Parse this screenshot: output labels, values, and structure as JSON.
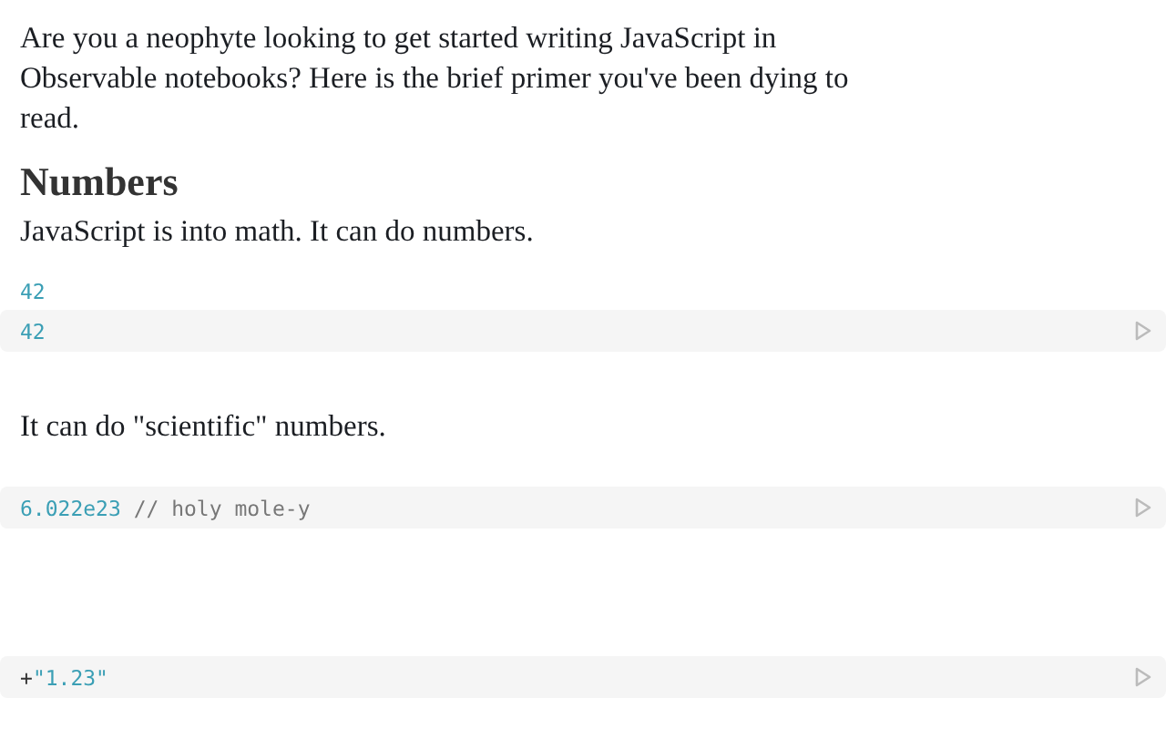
{
  "blocks": [
    {
      "kind": "paragraph",
      "text": "Are you a neophyte looking to get started writing JavaScript in Observable notebooks? Here is the brief primer you've been dying to read."
    },
    {
      "kind": "heading",
      "text": "Numbers"
    },
    {
      "kind": "paragraph",
      "text": "JavaScript is into math. It can do numbers."
    },
    {
      "kind": "output",
      "text": "42"
    },
    {
      "kind": "cell",
      "tokens": [
        {
          "kind": "number",
          "text": "42"
        }
      ]
    },
    {
      "kind": "paragraph",
      "text": "It can do \"scientific\" numbers."
    },
    {
      "kind": "cell",
      "tokens": [
        {
          "kind": "number",
          "text": "6.022e23"
        },
        {
          "kind": "comment",
          "text": " // holy mole-y"
        }
      ]
    },
    {
      "kind": "cell",
      "tokens": [
        {
          "kind": "operator",
          "text": "+"
        },
        {
          "kind": "string",
          "text": "\"1.23\""
        }
      ]
    }
  ]
}
